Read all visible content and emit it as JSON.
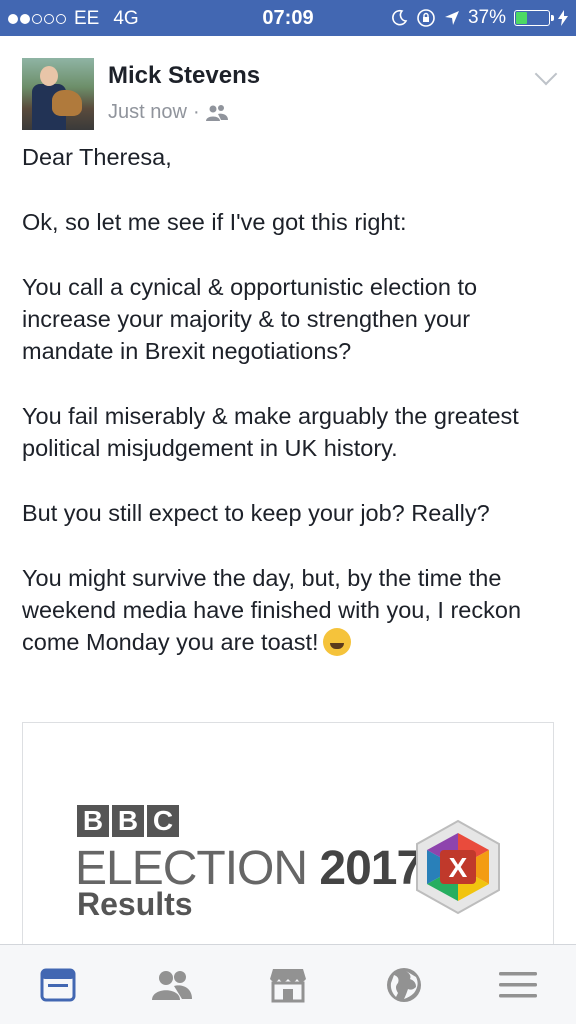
{
  "status_bar": {
    "signal_icon": "signal-dots-icon",
    "carrier": "EE",
    "network": "4G",
    "time": "07:09",
    "battery_percent": "37%",
    "battery_level": 0.37,
    "icons": [
      "moon-icon",
      "rotation-lock-icon",
      "location-arrow-icon",
      "battery-icon",
      "charging-bolt-icon"
    ]
  },
  "post": {
    "author": "Mick Stevens",
    "timestamp": "Just now",
    "separator": "·",
    "audience_icon": "friends-icon",
    "paragraphs": [
      "Dear Theresa,",
      "Ok, so let me see if I've got this right:",
      "You call a cynical & opportunistic election to increase your majority & to strengthen your mandate in Brexit negotiations?",
      "You fail miserably & make arguably the greatest political misjudgement in UK history.",
      "But you still expect to keep your job? Really?",
      "You might survive the day, but, by the time the weekend media have finished with you, I reckon come Monday you are toast!"
    ],
    "emoji": "rofl-emoji-icon"
  },
  "link_card": {
    "bbc_letters": [
      "B",
      "B",
      "C"
    ],
    "headline_word": "ELECTION",
    "headline_year": "2017",
    "subtitle": "Results",
    "logo_letter": "X"
  },
  "tab_bar": {
    "items": [
      "news-feed-icon",
      "friends-icon",
      "marketplace-icon",
      "globe-icon",
      "menu-icon"
    ],
    "active_color": "#4267b2",
    "inactive_color": "#929292"
  },
  "colors": {
    "brand_blue": "#4267b2",
    "battery_green": "#4cd964"
  }
}
